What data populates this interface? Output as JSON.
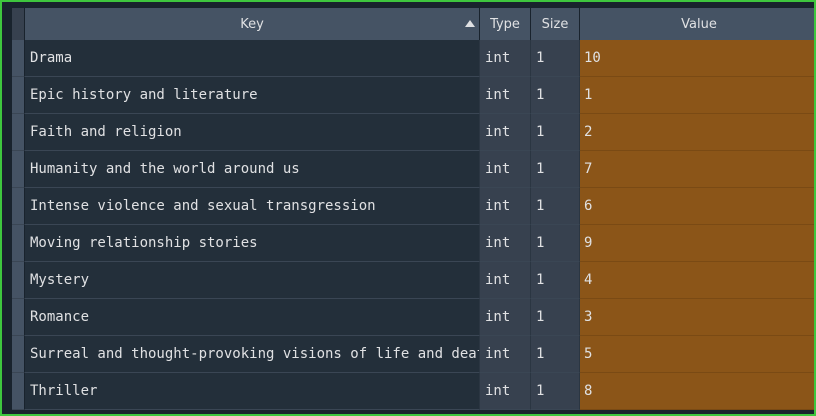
{
  "table": {
    "headers": {
      "key": "Key",
      "type": "Type",
      "size": "Size",
      "value": "Value"
    },
    "sort_icon": "sort-ascending-icon",
    "rows": [
      {
        "key": "Drama",
        "type": "int",
        "size": "1",
        "value": "10"
      },
      {
        "key": "Epic history and literature",
        "type": "int",
        "size": "1",
        "value": "1"
      },
      {
        "key": "Faith and religion",
        "type": "int",
        "size": "1",
        "value": "2"
      },
      {
        "key": "Humanity and the world around us",
        "type": "int",
        "size": "1",
        "value": "7"
      },
      {
        "key": "Intense violence and sexual transgression",
        "type": "int",
        "size": "1",
        "value": "6"
      },
      {
        "key": "Moving relationship stories",
        "type": "int",
        "size": "1",
        "value": "9"
      },
      {
        "key": "Mystery",
        "type": "int",
        "size": "1",
        "value": "4"
      },
      {
        "key": "Romance",
        "type": "int",
        "size": "1",
        "value": "3"
      },
      {
        "key": "Surreal and thought-provoking visions of life and death",
        "type": "int",
        "size": "1",
        "value": "5"
      },
      {
        "key": "Thriller",
        "type": "int",
        "size": "1",
        "value": "8"
      }
    ]
  },
  "colors": {
    "selection_border": "#3ec63e",
    "header_bg": "#455364",
    "value_bg": "#8b5518",
    "key_bg": "#232f3a",
    "type_size_bg": "#37414f"
  }
}
